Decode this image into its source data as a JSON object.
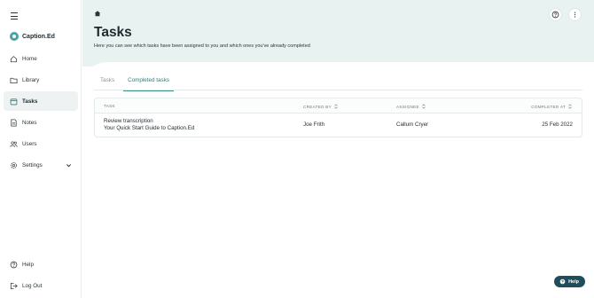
{
  "app": {
    "name": "Caption.Ed"
  },
  "sidebar": {
    "items": [
      {
        "label": "Home",
        "icon": "home-icon"
      },
      {
        "label": "Library",
        "icon": "folder-icon"
      },
      {
        "label": "Tasks",
        "icon": "calendar-icon",
        "active": true
      },
      {
        "label": "Notes",
        "icon": "document-icon"
      },
      {
        "label": "Users",
        "icon": "users-icon"
      },
      {
        "label": "Settings",
        "icon": "gear-icon"
      }
    ],
    "bottom": [
      {
        "label": "Help",
        "icon": "help-circle-icon"
      },
      {
        "label": "Log Out",
        "icon": "logout-icon"
      }
    ]
  },
  "header": {
    "title": "Tasks",
    "subtitle": "Here you can see which tasks have been assigned to you and which ones you've already completed"
  },
  "tabs": [
    {
      "label": "Tasks",
      "active": false
    },
    {
      "label": "Completed tasks",
      "active": true
    }
  ],
  "table": {
    "columns": [
      "TASK",
      "CREATED BY",
      "ASSIGNEE",
      "COMPLETED AT"
    ],
    "rows": [
      {
        "task_title": "Review transcription",
        "task_subtitle": "Your Quick Start Guide to Caption.Ed",
        "created_by": "Joe Frith",
        "assignee": "Callum Cryer",
        "completed_at": "25 Feb 2022"
      }
    ]
  },
  "help_button": {
    "label": "Help"
  },
  "colors": {
    "accent": "#3a8f8c",
    "hero_bg": "#e8f3f1",
    "help_bg": "#1f4e5a"
  }
}
